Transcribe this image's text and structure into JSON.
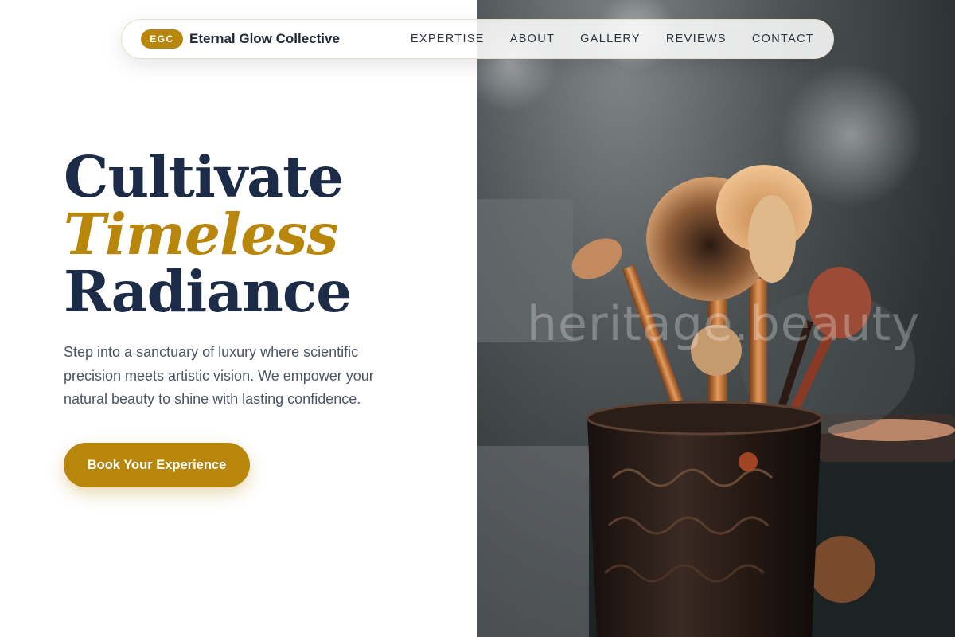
{
  "brand": {
    "badge": "EGC",
    "name": "Eternal Glow Collective"
  },
  "nav": {
    "items": [
      {
        "label": "EXPERTISE"
      },
      {
        "label": "ABOUT"
      },
      {
        "label": "GALLERY"
      },
      {
        "label": "REVIEWS"
      },
      {
        "label": "CONTACT"
      }
    ]
  },
  "hero": {
    "headline_line1": "Cultivate",
    "headline_line2": "Timeless",
    "headline_line3": "Radiance",
    "description": "Step into a sanctuary of luxury where scientific precision meets artistic vision. We empower your natural beauty to shine with lasting confidence.",
    "cta_label": "Book Your Experience",
    "image_watermark": "heritage.beauty"
  },
  "colors": {
    "accent": "#b8860b",
    "headline": "#1c2b47",
    "body_text": "#4b5563"
  }
}
